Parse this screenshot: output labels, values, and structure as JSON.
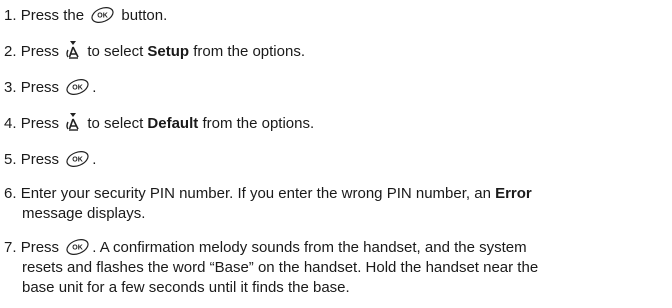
{
  "steps": [
    {
      "num": "1.",
      "pre": "Press the",
      "icon": "ok-button-icon",
      "post": "button."
    },
    {
      "num": "2.",
      "pre": "Press",
      "icon": "nav-down-icon",
      "mid": "to select",
      "bold": "Setup",
      "post": "from the options."
    },
    {
      "num": "3.",
      "pre": "Press",
      "icon": "ok-button-icon",
      "post": "."
    },
    {
      "num": "4.",
      "pre": "Press",
      "icon": "nav-down-icon",
      "mid": "to select",
      "bold": "Default",
      "post": "from the options."
    },
    {
      "num": "5.",
      "pre": "Press",
      "icon": "ok-button-icon",
      "post": "."
    },
    {
      "num": "6.",
      "line1_pre": "Enter your security PIN number. If you enter the wrong PIN number, an",
      "bold": "Error",
      "line2": "message displays."
    },
    {
      "num": "7.",
      "pre": "Press",
      "icon": "ok-button-icon",
      "line1_post": ". A confirmation melody sounds from the handset, and the system",
      "line2": "resets and flashes the word “Base” on the handset. Hold the handset near the",
      "line3": "base unit for a few seconds until it finds the base."
    }
  ],
  "icon_label": "OK"
}
